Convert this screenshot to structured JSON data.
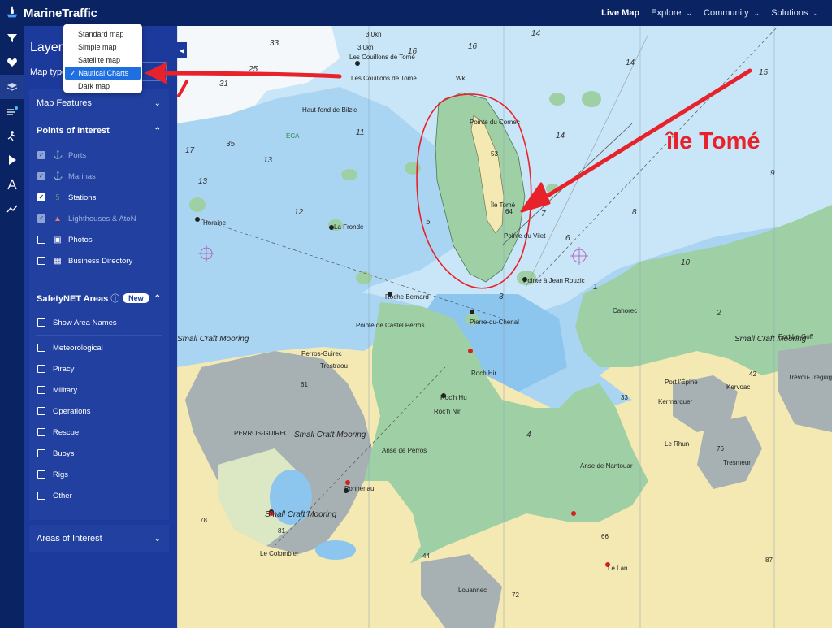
{
  "header": {
    "brand": "MarineTraffic",
    "nav": [
      {
        "label": "Live Map",
        "active": true,
        "dropdown": false
      },
      {
        "label": "Explore",
        "active": false,
        "dropdown": true
      },
      {
        "label": "Community",
        "active": false,
        "dropdown": true
      },
      {
        "label": "Solutions",
        "active": false,
        "dropdown": true
      }
    ]
  },
  "rail": [
    "filter-icon",
    "heart-icon",
    "layers-icon",
    "weather-icon",
    "route-icon",
    "play-icon",
    "compass-icon",
    "chart-line-icon"
  ],
  "panel": {
    "title": "Layers",
    "map_type_label": "Map type",
    "map_type_options": [
      "Standard map",
      "Simple map",
      "Satellite map",
      "Nautical Charts",
      "Dark map"
    ],
    "map_type_selected": "Nautical Charts",
    "map_features": {
      "label": "Map Features"
    },
    "points_of_interest": {
      "label": "Points of Interest",
      "items": [
        {
          "label": "Ports",
          "checked": true,
          "disabled": true,
          "icon": "anchor-icon"
        },
        {
          "label": "Marinas",
          "checked": true,
          "disabled": true,
          "icon": "marina-icon"
        },
        {
          "label": "Stations",
          "checked": true,
          "disabled": false,
          "icon": "station-icon"
        },
        {
          "label": "Lighthouses & AtoN",
          "checked": true,
          "disabled": true,
          "icon": "lighthouse-icon"
        },
        {
          "label": "Photos",
          "checked": false,
          "disabled": false,
          "icon": "photo-icon"
        },
        {
          "label": "Business Directory",
          "checked": false,
          "disabled": false,
          "icon": "building-icon"
        }
      ]
    },
    "safetynet": {
      "label": "SafetyNET Areas",
      "badge": "New",
      "show_names": "Show Area Names",
      "items": [
        "Meteorological",
        "Piracy",
        "Military",
        "Operations",
        "Rescue",
        "Buoys",
        "Rigs",
        "Other"
      ]
    },
    "areas_of_interest": {
      "label": "Areas of Interest"
    }
  },
  "map": {
    "annotation": "île Tomé",
    "labels": {
      "les_couillons": "Les Couillons de Tomé",
      "les_couillons_top": "Les Couillons de Tomé",
      "speed_1": "3.0kn",
      "speed_2": "3.0kn",
      "haut_fond": "Haut-fond de Bilzic",
      "fronde": "La Fronde",
      "horaine": "Horaine",
      "roche_bernard": "Roche Bernard",
      "castel_perros": "Pointe de Castel Perros",
      "pierre_chenal": "Pierre-du-Chenal",
      "pointe_jean": "Pointe à Jean Rouzic",
      "pointe_vilet": "Pointe du Vilet",
      "ile_tome": "Île Tomé",
      "ouest_de_carnet": "Pointe du Cornec",
      "small_craft_1": "Small Craft Mooring",
      "small_craft_2": "Small Craft Mooring",
      "small_craft_3": "Small Craft Mooring",
      "small_craft_4": "Small Craft Mooring",
      "perros_guirec": "PERROS-GUIREC",
      "trestraou": "Trestraou",
      "perros_guirec_pt": "Perros-Guirec",
      "anse_perros": "Anse de Perros",
      "anse_nantouar": "Anse de Nantouar",
      "roch_hu": "Roc'h Hu",
      "roch_nir": "Roc'h Nir",
      "roch_hir": "Roch Hir",
      "cahoreo": "Cahorec",
      "port_epine": "Port l'Épine",
      "kerrarquer": "Kermarquer",
      "le_rhun": "Le Rhun",
      "tresmene": "Tresmeur",
      "louannec": "Louannec",
      "le_colombier": "Le Colombier",
      "kervoac": "Kervoac",
      "le_lan": "Le Lan",
      "port_le_goff": "Port Le Goff",
      "trevou": "Trévou-Tréguignec",
      "eca": "ECA",
      "wk": "Wk",
      "ponhenau": "Ponhenau"
    },
    "depths": [
      "33",
      "31",
      "35",
      "25",
      "16",
      "17",
      "13",
      "15",
      "14",
      "16",
      "11",
      "14",
      "10",
      "12",
      "13",
      "14",
      "9",
      "8",
      "7",
      "6",
      "5",
      "4",
      "3",
      "2",
      "1"
    ],
    "spot_heights": [
      "53",
      "64",
      "61",
      "81",
      "33",
      "42",
      "76",
      "78",
      "66",
      "44",
      "72",
      "87"
    ]
  }
}
